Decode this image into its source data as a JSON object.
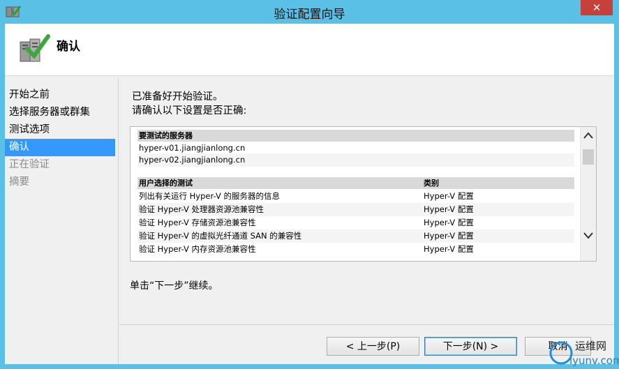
{
  "window": {
    "title": "验证配置向导",
    "close_label": "✕"
  },
  "header": {
    "title": "确认"
  },
  "nav": {
    "items": [
      {
        "label": "开始之前",
        "state": "normal"
      },
      {
        "label": "选择服务器或群集",
        "state": "normal"
      },
      {
        "label": "测试选项",
        "state": "normal"
      },
      {
        "label": "确认",
        "state": "active"
      },
      {
        "label": "正在验证",
        "state": "disabled"
      },
      {
        "label": "摘要",
        "state": "disabled"
      }
    ]
  },
  "content": {
    "intro_line1": "已准备好开始验证。",
    "intro_line2": "请确认以下设置是否正确:",
    "servers_header": "要测试的服务器",
    "servers": [
      "hyper-v01.jiangjianlong.cn",
      "hyper-v02.jiangjianlong.cn"
    ],
    "tests_header": "用户选择的测试",
    "category_header": "类别",
    "tests": [
      {
        "name": "列出有关运行 Hyper-V 的服务器的信息",
        "category": "Hyper-V 配置"
      },
      {
        "name": "验证 Hyper-V 处理器资源池兼容性",
        "category": "Hyper-V 配置"
      },
      {
        "name": "验证 Hyper-V 存储资源池兼容性",
        "category": "Hyper-V 配置"
      },
      {
        "name": "验证 Hyper-V 的虚拟光纤通道 SAN 的兼容性",
        "category": "Hyper-V 配置"
      },
      {
        "name": "验证 Hyper-V 内存资源池兼容性",
        "category": "Hyper-V 配置"
      }
    ],
    "continue_text": "单击“下一步”继续。"
  },
  "buttons": {
    "back": "< 上一步(P)",
    "next": "下一步(N) >",
    "cancel": "取消"
  },
  "watermark": {
    "brand": "运维网",
    "site": "iyunv.com"
  },
  "colors": {
    "title_bar": "#5bc0e6",
    "nav_active": "#3399ff",
    "close": "#c7413a"
  }
}
